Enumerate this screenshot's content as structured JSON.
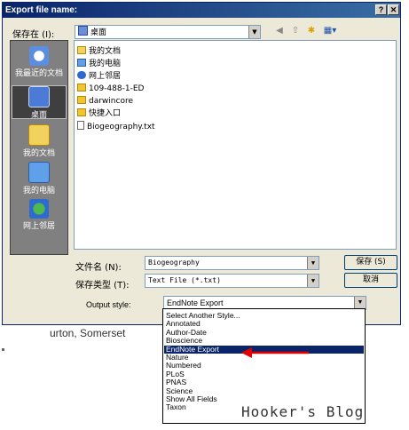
{
  "background": {
    "snippet": "urton, Somerset"
  },
  "dialog": {
    "title": "Export file name:",
    "help_btn": "?",
    "close_btn": "✕",
    "save_in_label": "保存在 (I):",
    "save_in_value": "桌面",
    "nav_items": [
      {
        "label": "我最近的文档",
        "icon": "recent-documents-icon"
      },
      {
        "label": "桌面",
        "icon": "desktop-icon",
        "active": true
      },
      {
        "label": "我的文档",
        "icon": "my-documents-icon"
      },
      {
        "label": "我的电脑",
        "icon": "my-computer-icon"
      },
      {
        "label": "网上邻居",
        "icon": "network-places-icon"
      }
    ],
    "files": [
      {
        "name": "我的文档",
        "type": "system"
      },
      {
        "name": "我的电脑",
        "type": "system"
      },
      {
        "name": "网上邻居",
        "type": "system"
      },
      {
        "name": "109-488-1-ED",
        "type": "folder"
      },
      {
        "name": "darwincore",
        "type": "folder"
      },
      {
        "name": "快捷入口",
        "type": "folder"
      },
      {
        "name": "Biogeography.txt",
        "type": "text"
      }
    ],
    "filename_label": "文件名 (N):",
    "filename_value": "Biogeography",
    "filetype_label": "保存类型 (T):",
    "filetype_value": "Text File (*.txt)",
    "save_button": "保存 (S)",
    "cancel_button": "取消",
    "output_style_label": "Output style:",
    "output_style_value": "EndNote Export"
  },
  "dropdown": {
    "items": [
      "Select Another Style...",
      "Annotated",
      "Author-Date",
      "Bioscience",
      "EndNote Export",
      "Nature",
      "Numbered",
      "PLoS",
      "PNAS",
      "Science",
      "Show All Fields",
      "Taxon"
    ],
    "selected_index": 4
  },
  "watermark": "Hooker's Blog",
  "colors": {
    "title_bar": "#0a246a",
    "dialog_bg": "#ece9d8",
    "arrow": "#e00000",
    "selection": "#0a246a"
  }
}
